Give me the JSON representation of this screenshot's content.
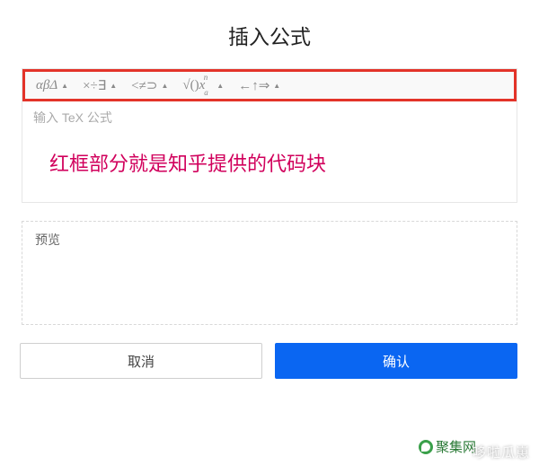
{
  "title": "插入公式",
  "toolbar": {
    "group_greek": "αβΔ",
    "group_ops": "×÷∃",
    "group_rel": "<≠⊃",
    "group_func": "√()",
    "group_func_xn": "x",
    "group_func_sub": "a",
    "group_func_sup": "n",
    "group_arrows": "←↑⇒"
  },
  "editor": {
    "placeholder": "输入 TeX 公式",
    "annotation": "红框部分就是知乎提供的代码块"
  },
  "preview": {
    "label": "预览"
  },
  "buttons": {
    "cancel": "取消",
    "confirm": "确认"
  },
  "watermarks": {
    "right": "哆啦瓜崽",
    "site": "聚集网"
  }
}
